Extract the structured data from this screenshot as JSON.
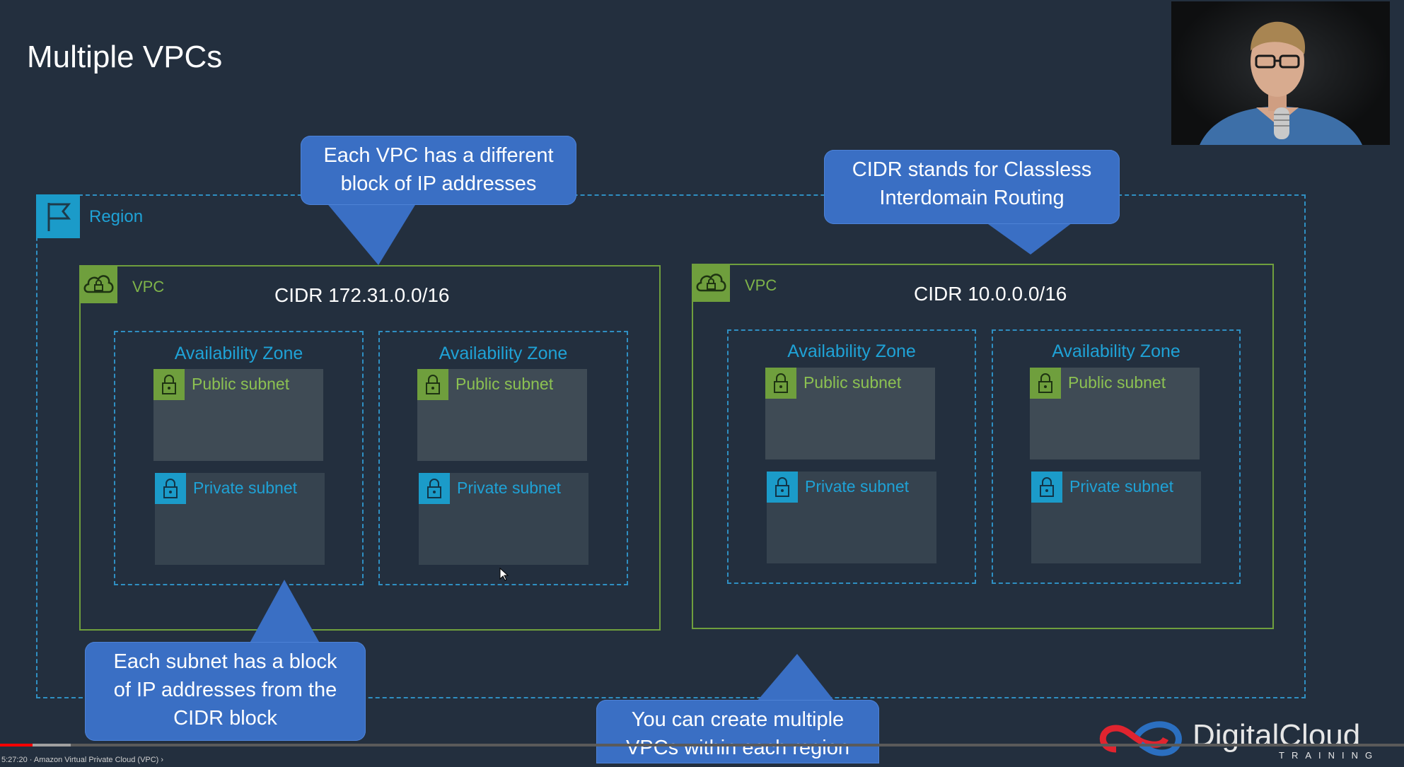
{
  "slide": {
    "title": "Multiple VPCs"
  },
  "region": {
    "label": "Region",
    "icon": "flag-icon"
  },
  "vpcs": [
    {
      "label": "VPC",
      "icon": "cloud-lock-icon",
      "cidr": "CIDR 172.31.0.0/16",
      "zones": [
        {
          "label": "Availability Zone",
          "public": "Public subnet",
          "private": "Private subnet"
        },
        {
          "label": "Availability Zone",
          "public": "Public subnet",
          "private": "Private subnet"
        }
      ]
    },
    {
      "label": "VPC",
      "icon": "cloud-lock-icon",
      "cidr": "CIDR 10.0.0.0/16",
      "zones": [
        {
          "label": "Availability Zone",
          "public": "Public subnet",
          "private": "Private subnet"
        },
        {
          "label": "Availability Zone",
          "public": "Public subnet",
          "private": "Private subnet"
        }
      ]
    }
  ],
  "callouts": {
    "vpc_block": [
      "Each VPC has a different",
      "block of IP addresses"
    ],
    "cidr_meaning": [
      "CIDR stands for Classless",
      "Interdomain Routing"
    ],
    "subnet_block": [
      "Each subnet has a block",
      "of IP addresses from the",
      "CIDR block"
    ],
    "multiple_vpcs": [
      "You can create multiple",
      "VPCs within each region"
    ]
  },
  "branding": {
    "logo_text": "DigitalCloud",
    "logo_sub": "TRAINING"
  },
  "player": {
    "caption": "5:27:20 · Amazon Virtual Private Cloud (VPC) ›",
    "progress_fraction": 0.023
  },
  "colors": {
    "background": "#232f3e",
    "region": "#1b9bc9",
    "vpc": "#6f9f3d",
    "callout": "#3a6fc4"
  }
}
